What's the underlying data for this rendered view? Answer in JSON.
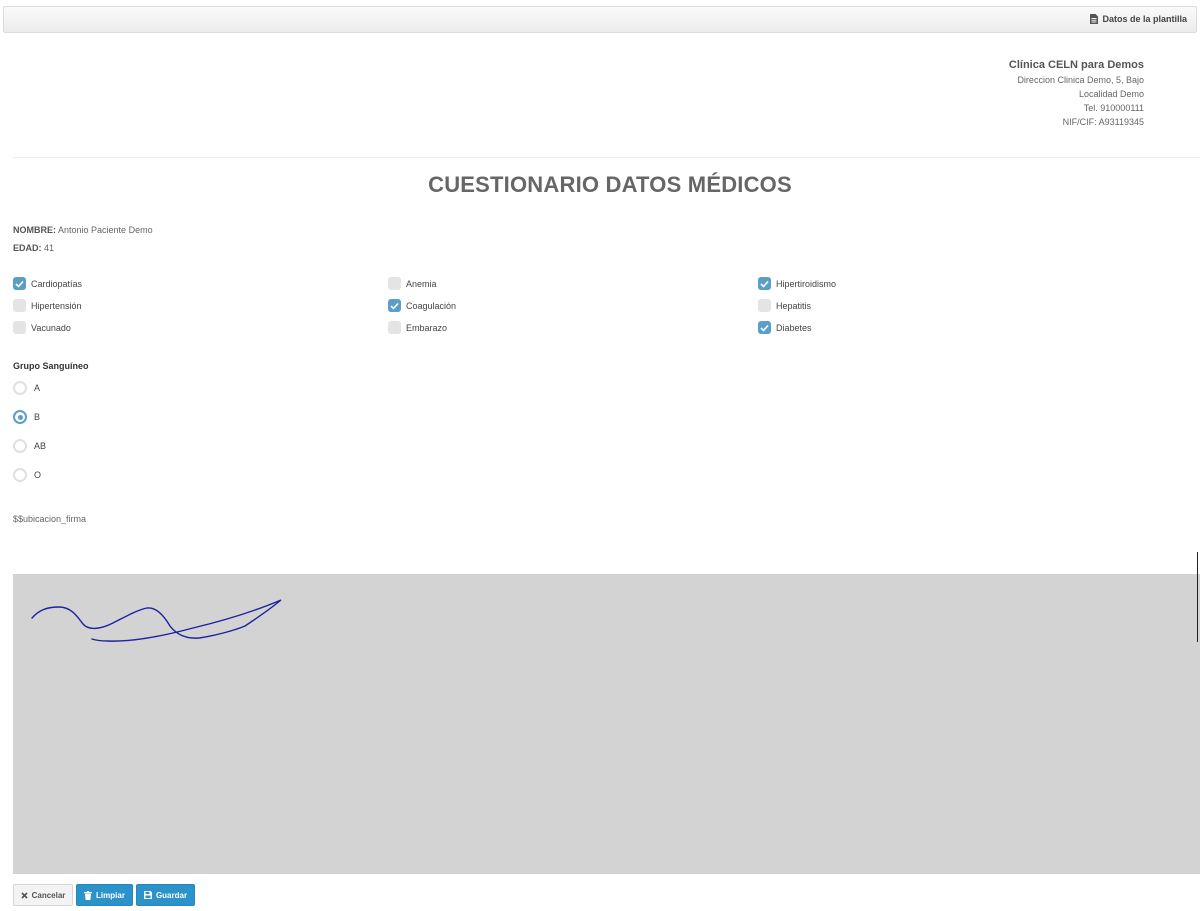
{
  "topbar": {
    "template_data_label": "Datos de la plantilla"
  },
  "clinic": {
    "name": "Clínica CELN para Demos",
    "address": "Direccion Clinica Demo, 5, Bajo",
    "locality": "Localidad Demo",
    "phone": "Tel. 910000111",
    "tax_id": "NIF/CIF: A93119345"
  },
  "form": {
    "title": "CUESTIONARIO DATOS MÉDICOS",
    "name_label": "NOMBRE:",
    "name_value": "Antonio Paciente Demo",
    "age_label": "EDAD:",
    "age_value": "41",
    "conditions": [
      {
        "label": "Cardiopatías",
        "checked": true
      },
      {
        "label": "Anemia",
        "checked": false
      },
      {
        "label": "Hipertiroidismo",
        "checked": true
      },
      {
        "label": "Hipertensión",
        "checked": false
      },
      {
        "label": "Coagulación",
        "checked": true
      },
      {
        "label": "Hepatitis",
        "checked": false
      },
      {
        "label": "Vacunado",
        "checked": false
      },
      {
        "label": "Embarazo",
        "checked": false
      },
      {
        "label": "Diabetes",
        "checked": true
      }
    ],
    "blood_group_title": "Grupo Sanguíneo",
    "blood_groups": [
      {
        "label": "A",
        "selected": false
      },
      {
        "label": "B",
        "selected": true
      },
      {
        "label": "AB",
        "selected": false
      },
      {
        "label": "O",
        "selected": false
      }
    ],
    "signature_placeholder": "$$ubicacion_firma"
  },
  "actions": {
    "cancel_label": "Cancelar",
    "clear_label": "Limpiar",
    "save_label": "Guardar"
  },
  "colors": {
    "accent": "#5b9fc8",
    "button_primary": "#2b93c9",
    "signature_pad": "#d3d3d3",
    "signature_ink": "#1c22a0"
  }
}
